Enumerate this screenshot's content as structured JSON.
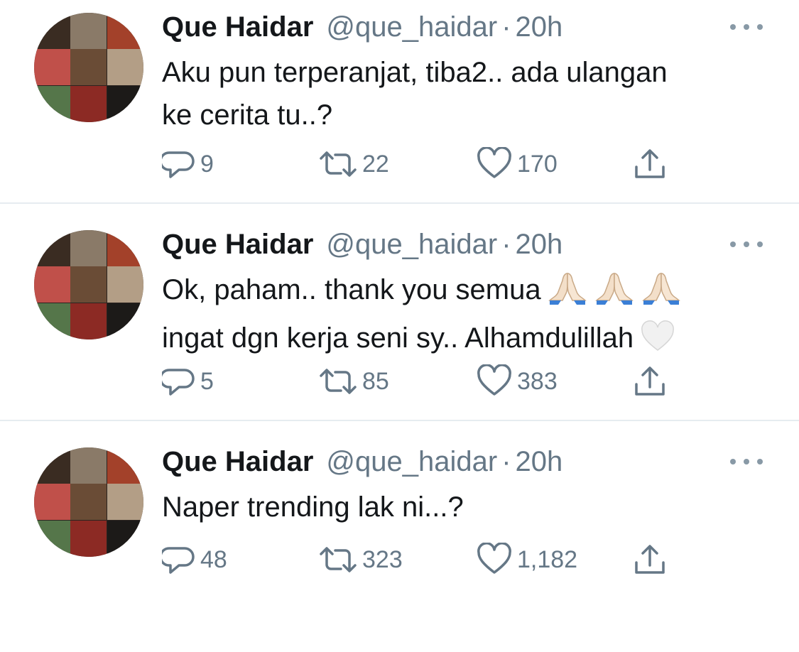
{
  "tweets": [
    {
      "name": "Que Haidar",
      "handle": "@que_haidar",
      "separator": "·",
      "time": "20h",
      "lines": [
        "Aku pun terperanjat, tiba2.. ada ulangan",
        "ke cerita tu..?"
      ],
      "replies": "9",
      "retweets": "22",
      "likes": "170"
    },
    {
      "name": "Que Haidar",
      "handle": "@que_haidar",
      "separator": "·",
      "time": "20h",
      "lines": [
        "Ok, paham.. thank you semua",
        "ingat dgn kerja seni sy.. Alhamdulillah"
      ],
      "replies": "5",
      "retweets": "85",
      "likes": "383"
    },
    {
      "name": "Que Haidar",
      "handle": "@que_haidar",
      "separator": "·",
      "time": "20h",
      "lines": [
        "Naper trending lak ni...?"
      ],
      "replies": "48",
      "retweets": "323",
      "likes": "1,182"
    }
  ],
  "icons": {
    "reply": "reply-icon",
    "retweet": "retweet-icon",
    "like": "heart-icon",
    "share": "share-icon",
    "more": "more-icon",
    "pray": "folded-hands-emoji",
    "white_heart": "white-heart-emoji"
  },
  "colors": {
    "text": "#14171a",
    "secondary": "#657786",
    "divider": "#e6ecf0",
    "icon": "#657786"
  }
}
